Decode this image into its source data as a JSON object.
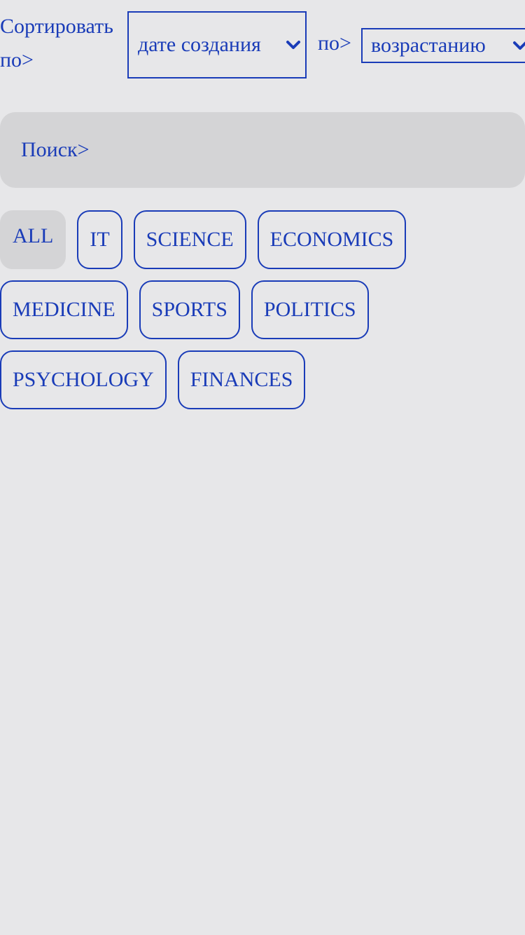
{
  "sort": {
    "label": "Сортировать по>",
    "by_value": "дате создания",
    "order_label": "по>",
    "order_value": "возрастанию"
  },
  "search": {
    "placeholder": "Поиск>"
  },
  "categories": [
    {
      "label": "ALL",
      "active": true
    },
    {
      "label": "IT",
      "active": false
    },
    {
      "label": "SCIENCE",
      "active": false
    },
    {
      "label": "ECONOMICS",
      "active": false
    },
    {
      "label": "MEDICINE",
      "active": false
    },
    {
      "label": "SPORTS",
      "active": false
    },
    {
      "label": "POLITICS",
      "active": false
    },
    {
      "label": "PSYCHOLOGY",
      "active": false
    },
    {
      "label": "FINANCES",
      "active": false
    }
  ],
  "colors": {
    "accent": "#1a3cb8",
    "background": "#e7e7e9",
    "surface": "#d4d4d6"
  },
  "icons": {
    "dropdown": "chevron-down-icon"
  }
}
